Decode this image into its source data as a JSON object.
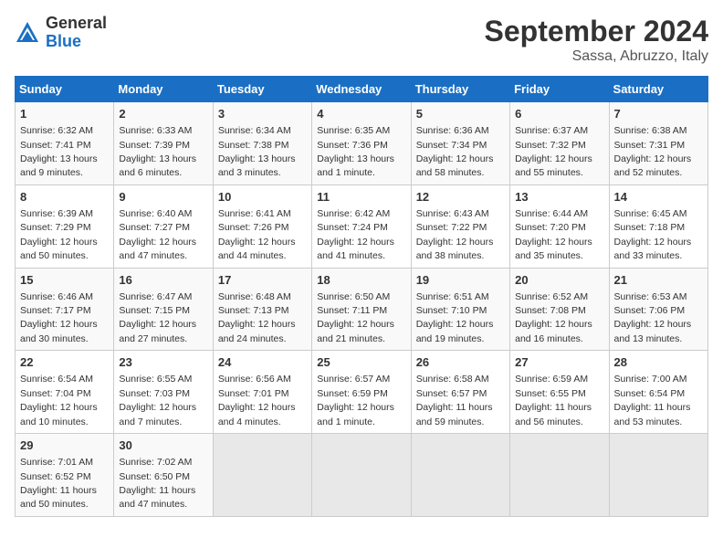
{
  "header": {
    "logo_general": "General",
    "logo_blue": "Blue",
    "month_title": "September 2024",
    "location": "Sassa, Abruzzo, Italy"
  },
  "days_of_week": [
    "Sunday",
    "Monday",
    "Tuesday",
    "Wednesday",
    "Thursday",
    "Friday",
    "Saturday"
  ],
  "weeks": [
    [
      {
        "day": 1,
        "info": "Sunrise: 6:32 AM\nSunset: 7:41 PM\nDaylight: 13 hours\nand 9 minutes."
      },
      {
        "day": 2,
        "info": "Sunrise: 6:33 AM\nSunset: 7:39 PM\nDaylight: 13 hours\nand 6 minutes."
      },
      {
        "day": 3,
        "info": "Sunrise: 6:34 AM\nSunset: 7:38 PM\nDaylight: 13 hours\nand 3 minutes."
      },
      {
        "day": 4,
        "info": "Sunrise: 6:35 AM\nSunset: 7:36 PM\nDaylight: 13 hours\nand 1 minute."
      },
      {
        "day": 5,
        "info": "Sunrise: 6:36 AM\nSunset: 7:34 PM\nDaylight: 12 hours\nand 58 minutes."
      },
      {
        "day": 6,
        "info": "Sunrise: 6:37 AM\nSunset: 7:32 PM\nDaylight: 12 hours\nand 55 minutes."
      },
      {
        "day": 7,
        "info": "Sunrise: 6:38 AM\nSunset: 7:31 PM\nDaylight: 12 hours\nand 52 minutes."
      }
    ],
    [
      {
        "day": 8,
        "info": "Sunrise: 6:39 AM\nSunset: 7:29 PM\nDaylight: 12 hours\nand 50 minutes."
      },
      {
        "day": 9,
        "info": "Sunrise: 6:40 AM\nSunset: 7:27 PM\nDaylight: 12 hours\nand 47 minutes."
      },
      {
        "day": 10,
        "info": "Sunrise: 6:41 AM\nSunset: 7:26 PM\nDaylight: 12 hours\nand 44 minutes."
      },
      {
        "day": 11,
        "info": "Sunrise: 6:42 AM\nSunset: 7:24 PM\nDaylight: 12 hours\nand 41 minutes."
      },
      {
        "day": 12,
        "info": "Sunrise: 6:43 AM\nSunset: 7:22 PM\nDaylight: 12 hours\nand 38 minutes."
      },
      {
        "day": 13,
        "info": "Sunrise: 6:44 AM\nSunset: 7:20 PM\nDaylight: 12 hours\nand 35 minutes."
      },
      {
        "day": 14,
        "info": "Sunrise: 6:45 AM\nSunset: 7:18 PM\nDaylight: 12 hours\nand 33 minutes."
      }
    ],
    [
      {
        "day": 15,
        "info": "Sunrise: 6:46 AM\nSunset: 7:17 PM\nDaylight: 12 hours\nand 30 minutes."
      },
      {
        "day": 16,
        "info": "Sunrise: 6:47 AM\nSunset: 7:15 PM\nDaylight: 12 hours\nand 27 minutes."
      },
      {
        "day": 17,
        "info": "Sunrise: 6:48 AM\nSunset: 7:13 PM\nDaylight: 12 hours\nand 24 minutes."
      },
      {
        "day": 18,
        "info": "Sunrise: 6:50 AM\nSunset: 7:11 PM\nDaylight: 12 hours\nand 21 minutes."
      },
      {
        "day": 19,
        "info": "Sunrise: 6:51 AM\nSunset: 7:10 PM\nDaylight: 12 hours\nand 19 minutes."
      },
      {
        "day": 20,
        "info": "Sunrise: 6:52 AM\nSunset: 7:08 PM\nDaylight: 12 hours\nand 16 minutes."
      },
      {
        "day": 21,
        "info": "Sunrise: 6:53 AM\nSunset: 7:06 PM\nDaylight: 12 hours\nand 13 minutes."
      }
    ],
    [
      {
        "day": 22,
        "info": "Sunrise: 6:54 AM\nSunset: 7:04 PM\nDaylight: 12 hours\nand 10 minutes."
      },
      {
        "day": 23,
        "info": "Sunrise: 6:55 AM\nSunset: 7:03 PM\nDaylight: 12 hours\nand 7 minutes."
      },
      {
        "day": 24,
        "info": "Sunrise: 6:56 AM\nSunset: 7:01 PM\nDaylight: 12 hours\nand 4 minutes."
      },
      {
        "day": 25,
        "info": "Sunrise: 6:57 AM\nSunset: 6:59 PM\nDaylight: 12 hours\nand 1 minute."
      },
      {
        "day": 26,
        "info": "Sunrise: 6:58 AM\nSunset: 6:57 PM\nDaylight: 11 hours\nand 59 minutes."
      },
      {
        "day": 27,
        "info": "Sunrise: 6:59 AM\nSunset: 6:55 PM\nDaylight: 11 hours\nand 56 minutes."
      },
      {
        "day": 28,
        "info": "Sunrise: 7:00 AM\nSunset: 6:54 PM\nDaylight: 11 hours\nand 53 minutes."
      }
    ],
    [
      {
        "day": 29,
        "info": "Sunrise: 7:01 AM\nSunset: 6:52 PM\nDaylight: 11 hours\nand 50 minutes."
      },
      {
        "day": 30,
        "info": "Sunrise: 7:02 AM\nSunset: 6:50 PM\nDaylight: 11 hours\nand 47 minutes."
      },
      null,
      null,
      null,
      null,
      null
    ]
  ]
}
